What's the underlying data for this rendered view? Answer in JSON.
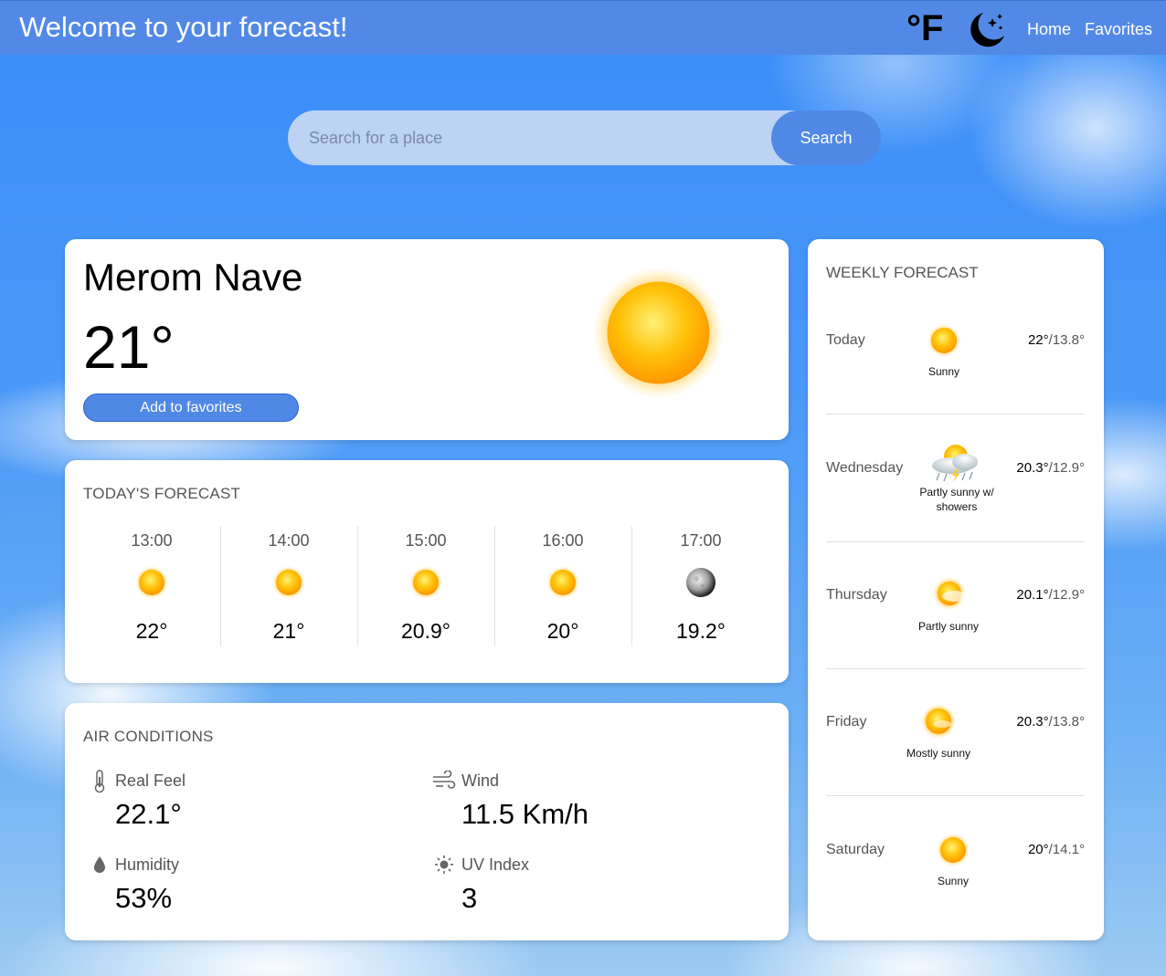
{
  "header": {
    "title": "Welcome to your forecast!",
    "unit_toggle": "°F",
    "theme_icon": "moon-stars-icon",
    "nav": {
      "home": "Home",
      "favorites": "Favorites"
    }
  },
  "search": {
    "placeholder": "Search for a place",
    "button": "Search"
  },
  "current": {
    "city": "Merom Nave",
    "temperature": "21°",
    "add_favorite": "Add to favorites",
    "icon": "sun-icon"
  },
  "today": {
    "title": "TODAY'S FORECAST",
    "hours": [
      {
        "time": "13:00",
        "temp": "22°",
        "icon": "sun-icon"
      },
      {
        "time": "14:00",
        "temp": "21°",
        "icon": "sun-icon"
      },
      {
        "time": "15:00",
        "temp": "20.9°",
        "icon": "sun-icon"
      },
      {
        "time": "16:00",
        "temp": "20°",
        "icon": "sun-icon"
      },
      {
        "time": "17:00",
        "temp": "19.2°",
        "icon": "moon-icon"
      }
    ]
  },
  "air": {
    "title": "AIR CONDITIONS",
    "real_feel": {
      "label": "Real Feel",
      "value": "22.1°",
      "icon": "thermometer-icon"
    },
    "wind": {
      "label": "Wind",
      "value": "11.5 Km/h",
      "icon": "wind-icon"
    },
    "humidity": {
      "label": "Humidity",
      "value": "53%",
      "icon": "droplet-icon"
    },
    "uv": {
      "label": "UV Index",
      "value": "3",
      "icon": "uv-sun-icon"
    }
  },
  "weekly": {
    "title": "WEEKLY FORECAST",
    "days": [
      {
        "day": "Today",
        "condition": "Sunny",
        "high": "22°",
        "low": "/13.8°",
        "icon": "sun-icon"
      },
      {
        "day": "Wednesday",
        "condition_line1": "Partly sunny w/",
        "condition_line2": "showers",
        "high": "20.3°",
        "low": "/12.9°",
        "icon": "partly-sunny-showers-icon"
      },
      {
        "day": "Thursday",
        "condition": "Partly sunny",
        "high": "20.1°",
        "low": "/12.9°",
        "icon": "partly-sunny-icon"
      },
      {
        "day": "Friday",
        "condition": "Mostly sunny",
        "high": "20.3°",
        "low": "/13.8°",
        "icon": "mostly-sunny-icon"
      },
      {
        "day": "Saturday",
        "condition": "Sunny",
        "high": "20°",
        "low": "/14.1°",
        "icon": "sun-icon"
      }
    ]
  },
  "colors": {
    "header_bar": "#5389e6",
    "accent_button": "#5088e5",
    "search_field": "#bcd3f4",
    "sun_core": "#ffc107",
    "card": "#ffffff"
  }
}
